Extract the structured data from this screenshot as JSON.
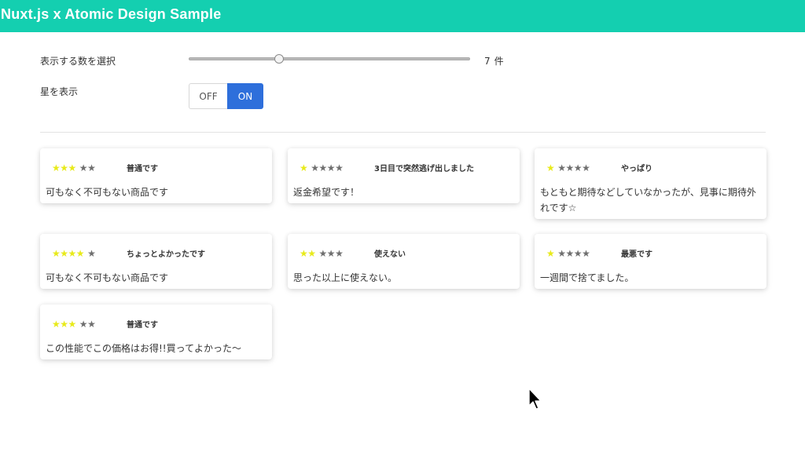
{
  "header": {
    "title": "Nuxt.js x Atomic Design Sample"
  },
  "controls": {
    "count_label": "表示する数を選択",
    "count_value": "7",
    "count_unit": "件",
    "count_max": 12,
    "star_label": "星を表示",
    "toggle_off": "OFF",
    "toggle_on": "ON",
    "toggle_selected": "ON"
  },
  "colors": {
    "header": "#14cfb0",
    "star_on": "#e8ea1a",
    "star_off": "#6f6f6f",
    "toggle_on": "#2e6fdb"
  },
  "reviews": [
    {
      "rating": 3,
      "title": "普通です",
      "body": "可もなく不可もない商品です"
    },
    {
      "rating": 1,
      "title": "3日目で突然逃げ出しました",
      "body": "返金希望です！"
    },
    {
      "rating": 1,
      "title": "やっぱり",
      "body": "もともと期待などしていなかったが、見事に期待外れです☆"
    },
    {
      "rating": 4,
      "title": "ちょっとよかったです",
      "body": "可もなく不可もない商品です"
    },
    {
      "rating": 2,
      "title": "使えない",
      "body": "思った以上に使えない。"
    },
    {
      "rating": 1,
      "title": "最悪です",
      "body": "一週間で捨てました。"
    },
    {
      "rating": 3,
      "title": "普通です",
      "body": "この性能でこの価格はお得!!買ってよかった〜"
    }
  ]
}
